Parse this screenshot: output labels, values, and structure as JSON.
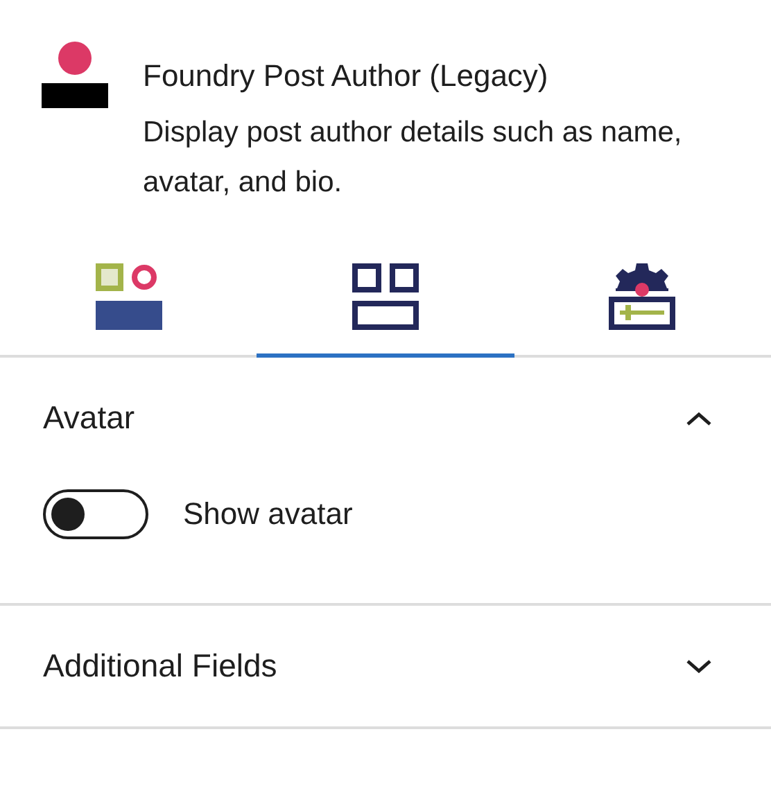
{
  "block": {
    "title": "Foundry Post Author (Legacy)",
    "description": "Display post author details such as name, avatar, and bio."
  },
  "tabs": [
    {
      "kind": "styles",
      "selected": false
    },
    {
      "kind": "layout",
      "selected": true
    },
    {
      "kind": "settings",
      "selected": false
    }
  ],
  "panels": [
    {
      "title": "Avatar",
      "expanded": true,
      "controls": [
        {
          "kind": "toggle",
          "label": "Show avatar",
          "on": false
        }
      ]
    },
    {
      "title": "Additional Fields",
      "expanded": false
    }
  ]
}
